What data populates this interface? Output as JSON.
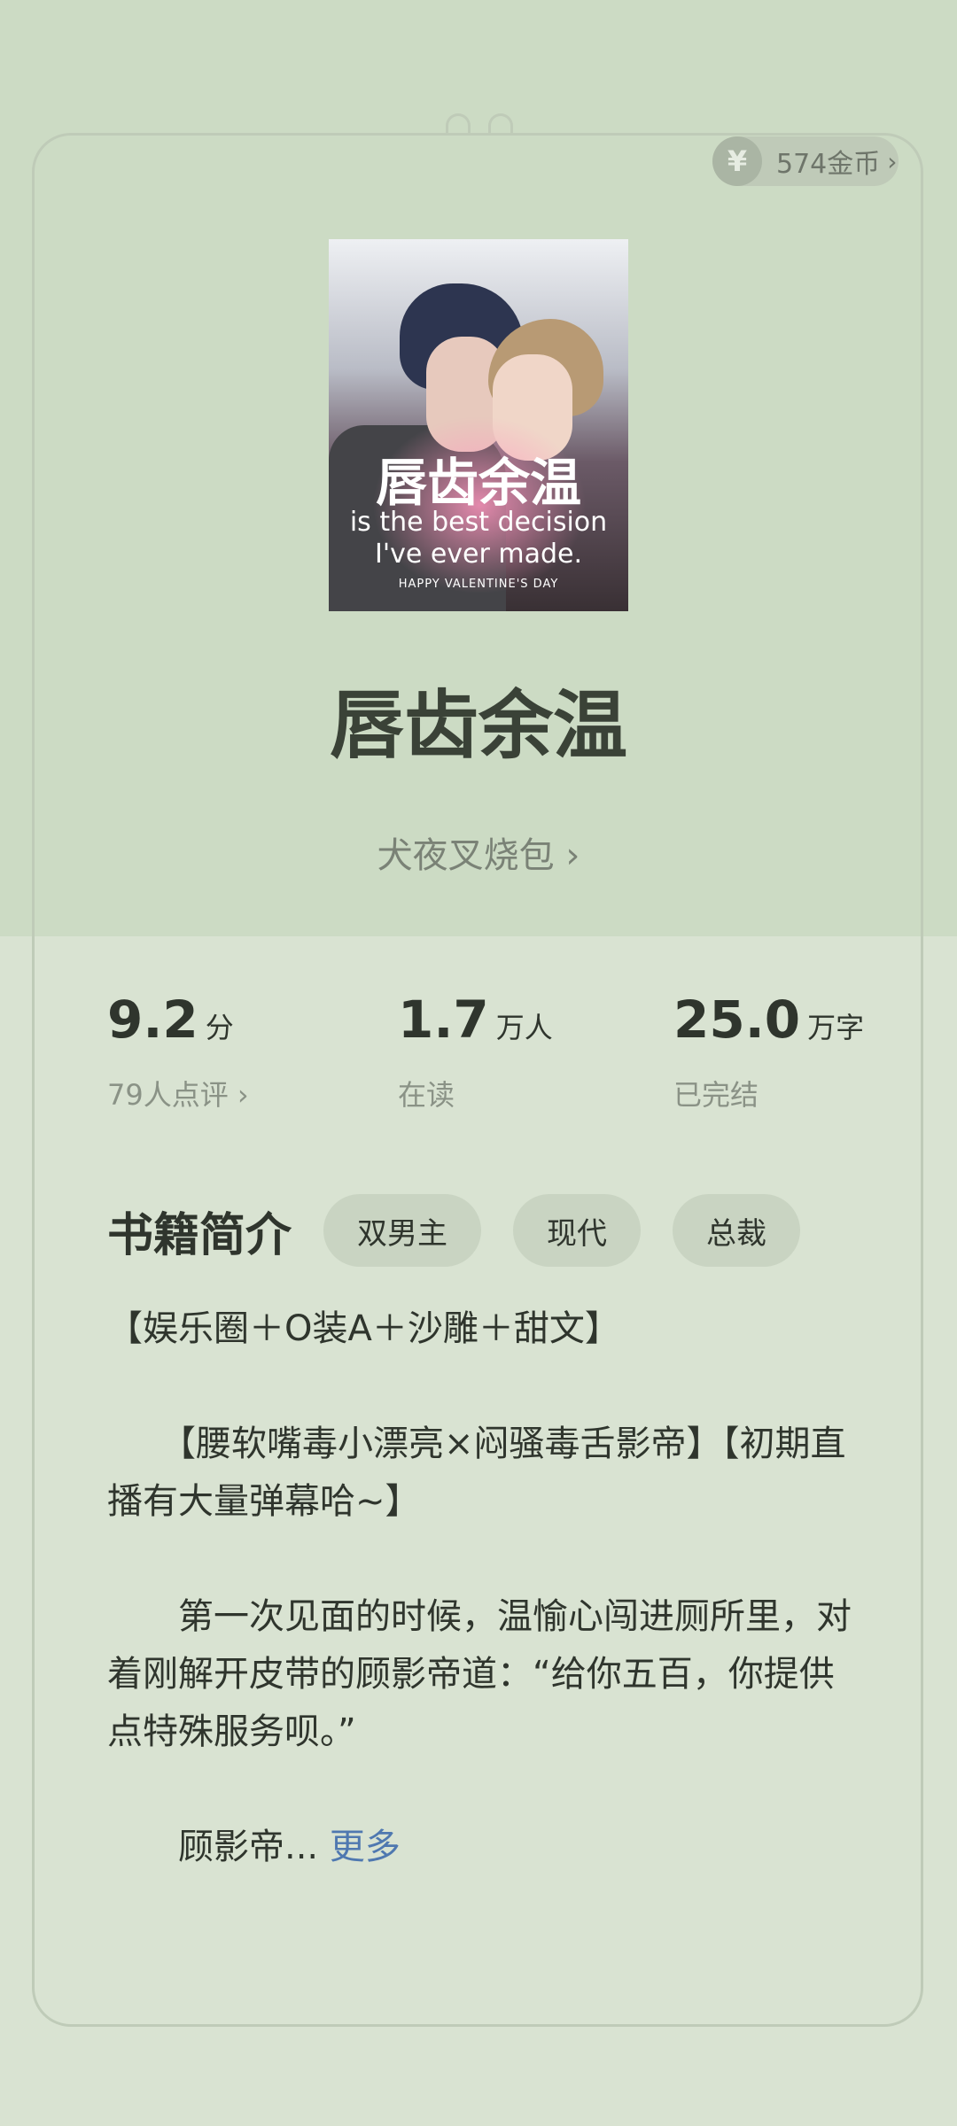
{
  "header": {
    "coins_label": "574金币",
    "coin_symbol": "¥",
    "chevron": "›"
  },
  "book": {
    "cover": {
      "title": "唇齿余温",
      "line1": "is the best decision",
      "line2": "I've ever made.",
      "line3": "HAPPY VALENTINE'S DAY"
    },
    "title": "唇齿余温",
    "author": "犬夜叉烧包 ›"
  },
  "stats": [
    {
      "value": "9.2",
      "unit": "分",
      "sub": "79人点评 ›"
    },
    {
      "value": "1.7",
      "unit": "万人",
      "sub": "在读"
    },
    {
      "value": "25.0",
      "unit": "万字",
      "sub": "已完结"
    }
  ],
  "intro": {
    "title": "书籍简介",
    "tags": [
      "双男主",
      "现代",
      "总裁"
    ],
    "text": "【娱乐圈＋O装A＋沙雕＋甜文】\n\n　　【腰软嘴毒小漂亮×闷骚毒舌影帝】【初期直播有大量弹幕哈~】\n\n　　第一次见面的时候，温愉心闯进厕所里，对着刚解开皮带的顾影帝道：“给你五百，你提供点特殊服务呗。”\n\n　　顾影帝... ",
    "more": "更多"
  },
  "colors": {
    "background": "#d9e3d2",
    "top_band": "#ccdbc4",
    "link": "#4f78b0"
  }
}
